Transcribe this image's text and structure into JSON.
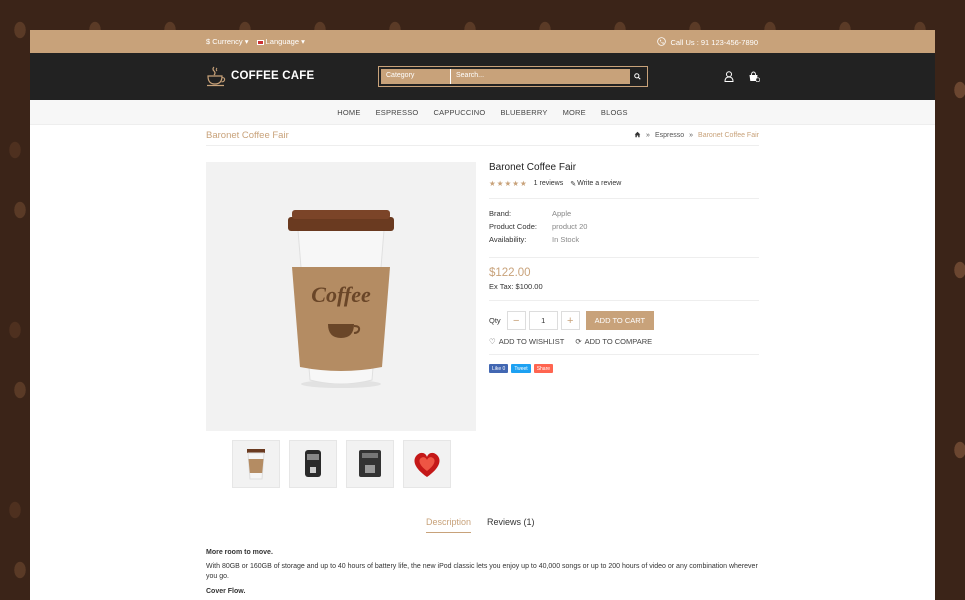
{
  "topbar": {
    "currency": "$ Currency",
    "language": "Language",
    "call": "Call Us : 91 123-456-7890"
  },
  "header": {
    "logo": "COFFEE CAFE",
    "category": "Category",
    "search_placeholder": "Search..."
  },
  "nav": [
    "HOME",
    "ESPRESSO",
    "CAPPUCCINO",
    "BLUEBERRY",
    "MORE",
    "BLOGS"
  ],
  "page": {
    "title": "Baronet Coffee Fair",
    "breadcrumb": [
      "Espresso",
      "Baronet Coffee Fair"
    ]
  },
  "product": {
    "name": "Baronet Coffee Fair",
    "rating": 5,
    "reviews": "1 reviews",
    "write_review": "Write a review",
    "brand_label": "Brand:",
    "brand": "Apple",
    "code_label": "Product Code:",
    "code": "product 20",
    "avail_label": "Availability:",
    "avail": "In Stock",
    "price": "$122.00",
    "tax": "Ex Tax: $100.00",
    "qty_label": "Qty",
    "qty": "1",
    "add_to_cart": "ADD TO CART",
    "wishlist": "ADD TO WISHLIST",
    "compare": "ADD TO COMPARE",
    "cup_text": "Coffee"
  },
  "social": {
    "like": "Like 0",
    "tweet": "Tweet",
    "share": "Share"
  },
  "tabs": {
    "description": "Description",
    "reviews": "Reviews (1)"
  },
  "description": {
    "heading1": "More room to move.",
    "para1": "With 80GB or 160GB of storage and up to 40 hours of battery life, the new iPod classic lets you enjoy up to 40,000 songs or up to 200 hours of video or any combination wherever you go.",
    "heading2": "Cover Flow."
  },
  "colors": {
    "accent": "#c8a27a",
    "dark": "#222222"
  }
}
